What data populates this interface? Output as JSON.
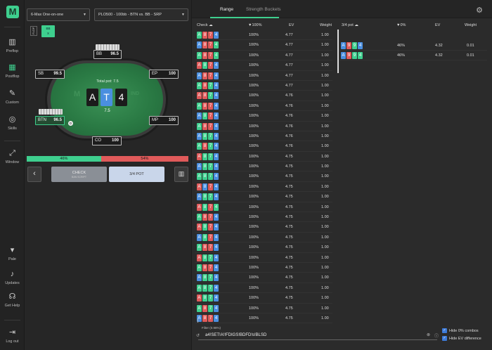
{
  "sidebar": {
    "logo": "M",
    "items": [
      {
        "label": "Preflop",
        "icon": "preflop-icon",
        "glyph": "▥"
      },
      {
        "label": "Postflop",
        "icon": "postflop-icon",
        "glyph": "▦"
      },
      {
        "label": "Custom",
        "icon": "custom-icon",
        "glyph": "✎"
      },
      {
        "label": "Skills",
        "icon": "skills-icon",
        "glyph": "◎"
      },
      {
        "label": "Window",
        "icon": "window-icon",
        "glyph": "⤢"
      },
      {
        "label": "Pale",
        "icon": "pale-icon",
        "glyph": "▾"
      },
      {
        "label": "Updates",
        "icon": "updates-icon",
        "glyph": "♪"
      },
      {
        "label": "Get Help",
        "icon": "help-icon",
        "glyph": "☊"
      },
      {
        "label": "Log out",
        "icon": "logout-icon",
        "glyph": "⇥"
      }
    ]
  },
  "header": {
    "game_select": "6-Max One-on-one",
    "spot_select": "PLO500 - 100bb - BTN vs. BB - SRP",
    "flop_label": "FLOP",
    "flop_chip": {
      "top": "BB",
      "bottom": "X"
    }
  },
  "table": {
    "total_pot_label": "Total pot: 7.5",
    "pot": "7.5",
    "board": [
      "A",
      "T",
      "4"
    ],
    "brand_m": "M",
    "brand_tail": "IND",
    "seats": {
      "bb": {
        "name": "BB",
        "stack": "96.5"
      },
      "sb": {
        "name": "SB",
        "stack": "99.5"
      },
      "ep": {
        "name": "EP",
        "stack": "100"
      },
      "btn": {
        "name": "BTN",
        "stack": "96.5"
      },
      "mp": {
        "name": "MP",
        "stack": "100"
      },
      "co": {
        "name": "CO",
        "stack": "100"
      }
    },
    "dealer": "D"
  },
  "equity": {
    "left": "46%",
    "right": "54%",
    "left_frac": 0.46
  },
  "actions": {
    "back": "‹",
    "check": "CHECK",
    "check_sub": "BAN SCRIPT",
    "pot34": "3/4 POT",
    "ctrl_icon": "▥"
  },
  "tabs": {
    "range": "Range",
    "strength": "Strength Buckets"
  },
  "check_table": {
    "title": "Check",
    "headers": [
      "▼100%",
      "EV",
      "Weight"
    ],
    "rows": [
      {
        "suits": [
          "g",
          "r",
          "r",
          "b"
        ],
        "f": "100%",
        "ev": "4.77",
        "w": "1.00"
      },
      {
        "suits": [
          "b",
          "r",
          "r",
          "g"
        ],
        "f": "100%",
        "ev": "4.77",
        "w": "1.00"
      },
      {
        "suits": [
          "g",
          "r",
          "r",
          "g"
        ],
        "f": "100%",
        "ev": "4.77",
        "w": "1.00"
      },
      {
        "suits": [
          "r",
          "g",
          "r",
          "b"
        ],
        "f": "100%",
        "ev": "4.77",
        "w": "1.00"
      },
      {
        "suits": [
          "b",
          "r",
          "r",
          "b"
        ],
        "f": "100%",
        "ev": "4.77",
        "w": "1.00"
      },
      {
        "suits": [
          "g",
          "r",
          "g",
          "b"
        ],
        "f": "100%",
        "ev": "4.77",
        "w": "1.00"
      },
      {
        "suits": [
          "r",
          "r",
          "g",
          "b"
        ],
        "f": "100%",
        "ev": "4.76",
        "w": "1.00"
      },
      {
        "suits": [
          "g",
          "r",
          "r",
          "b"
        ],
        "f": "100%",
        "ev": "4.76",
        "w": "1.00"
      },
      {
        "suits": [
          "b",
          "g",
          "r",
          "b"
        ],
        "f": "100%",
        "ev": "4.76",
        "w": "1.00"
      },
      {
        "suits": [
          "g",
          "r",
          "r",
          "b"
        ],
        "f": "100%",
        "ev": "4.76",
        "w": "1.00"
      },
      {
        "suits": [
          "b",
          "g",
          "g",
          "b"
        ],
        "f": "100%",
        "ev": "4.76",
        "w": "1.00"
      },
      {
        "suits": [
          "g",
          "r",
          "g",
          "b"
        ],
        "f": "100%",
        "ev": "4.76",
        "w": "1.00"
      },
      {
        "suits": [
          "r",
          "g",
          "g",
          "b"
        ],
        "f": "100%",
        "ev": "4.75",
        "w": "1.00"
      },
      {
        "suits": [
          "b",
          "g",
          "g",
          "b"
        ],
        "f": "100%",
        "ev": "4.75",
        "w": "1.00"
      },
      {
        "suits": [
          "g",
          "g",
          "g",
          "b"
        ],
        "f": "100%",
        "ev": "4.75",
        "w": "1.00"
      },
      {
        "suits": [
          "r",
          "b",
          "r",
          "b"
        ],
        "f": "100%",
        "ev": "4.75",
        "w": "1.00"
      },
      {
        "suits": [
          "b",
          "g",
          "g",
          "b"
        ],
        "f": "100%",
        "ev": "4.75",
        "w": "1.00"
      },
      {
        "suits": [
          "r",
          "g",
          "r",
          "g"
        ],
        "f": "100%",
        "ev": "4.75",
        "w": "1.00"
      },
      {
        "suits": [
          "g",
          "r",
          "r",
          "b"
        ],
        "f": "100%",
        "ev": "4.75",
        "w": "1.00"
      },
      {
        "suits": [
          "r",
          "g",
          "r",
          "b"
        ],
        "f": "100%",
        "ev": "4.75",
        "w": "1.00"
      },
      {
        "suits": [
          "b",
          "g",
          "r",
          "b"
        ],
        "f": "100%",
        "ev": "4.75",
        "w": "1.00"
      },
      {
        "suits": [
          "g",
          "r",
          "r",
          "b"
        ],
        "f": "100%",
        "ev": "4.75",
        "w": "1.00"
      },
      {
        "suits": [
          "r",
          "g",
          "g",
          "b"
        ],
        "f": "100%",
        "ev": "4.75",
        "w": "1.00"
      },
      {
        "suits": [
          "g",
          "r",
          "r",
          "b"
        ],
        "f": "100%",
        "ev": "4.75",
        "w": "1.00"
      },
      {
        "suits": [
          "b",
          "g",
          "g",
          "b"
        ],
        "f": "100%",
        "ev": "4.75",
        "w": "1.00"
      },
      {
        "suits": [
          "g",
          "g",
          "g",
          "b"
        ],
        "f": "100%",
        "ev": "4.75",
        "w": "1.00"
      },
      {
        "suits": [
          "r",
          "g",
          "g",
          "b"
        ],
        "f": "100%",
        "ev": "4.75",
        "w": "1.00"
      },
      {
        "suits": [
          "g",
          "r",
          "g",
          "b"
        ],
        "f": "100%",
        "ev": "4.75",
        "w": "1.00"
      },
      {
        "suits": [
          "b",
          "r",
          "r",
          "b"
        ],
        "f": "100%",
        "ev": "4.75",
        "w": "1.00"
      }
    ]
  },
  "pot_table": {
    "title": "3/4 pot",
    "headers": [
      "▼0%",
      "EV",
      "Weight"
    ],
    "rows": [
      {
        "suits": [
          "b",
          "r",
          "g",
          "b"
        ],
        "f": "46%",
        "ev": "4.32",
        "w": "0.01"
      },
      {
        "suits": [
          "b",
          "r",
          "g",
          "g"
        ],
        "f": "46%",
        "ev": "4.32",
        "w": "0.01"
      }
    ]
  },
  "filter": {
    "label": "Filter (0.98%)",
    "value": "a4!SET!A!!FDIGS!BDFD!s!BLSD"
  },
  "options": {
    "hide_zero": "Hide 0% combos",
    "hide_ev": "Hide EV difference"
  },
  "colors": {
    "green": "#3ecf8e",
    "red": "#e05a5a",
    "blue": "#4a8fe0"
  }
}
